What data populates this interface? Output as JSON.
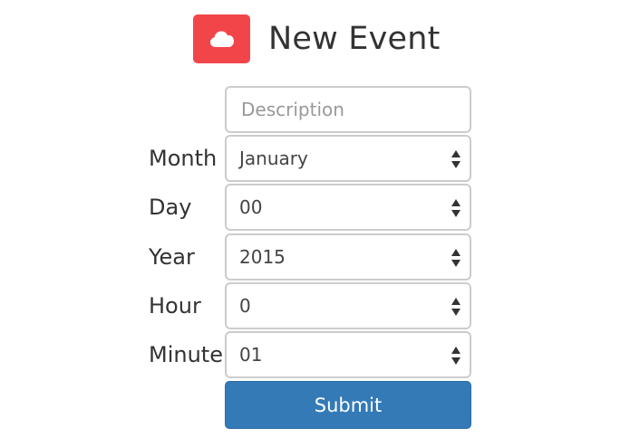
{
  "header": {
    "logo_icon": "cloud-icon",
    "title": "New Event",
    "logo_color": "#f2454a"
  },
  "form": {
    "description": {
      "placeholder": "Description",
      "value": ""
    },
    "month": {
      "label": "Month",
      "value": "January"
    },
    "day": {
      "label": "Day",
      "value": "00"
    },
    "year": {
      "label": "Year",
      "value": "2015"
    },
    "hour": {
      "label": "Hour",
      "value": "0"
    },
    "minute": {
      "label": "Minute",
      "value": "01"
    },
    "submit_label": "Submit",
    "submit_color": "#337ab7",
    "select_arrow_icon": "up-down-caret-icon"
  }
}
